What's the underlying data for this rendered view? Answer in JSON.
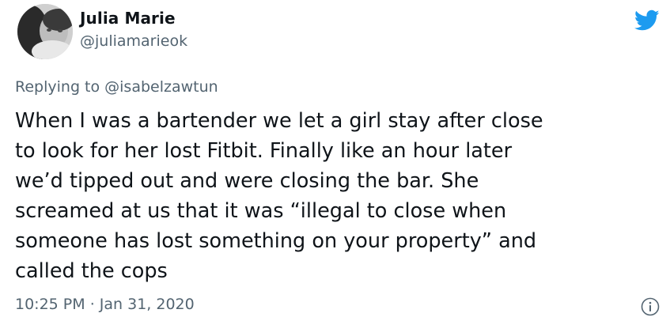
{
  "tweet": {
    "author_name": "Julia Marie",
    "author_handle": "@juliamarieok",
    "replying_prefix": "Replying to ",
    "replying_to": "@isabelzawtun",
    "lines": [
      "When I was a bartender we let a girl stay after close",
      "to look for her lost Fitbit. Finally like an hour later",
      "we’d tipped out and were closing the bar. She",
      "screamed at us that it was “illegal to close when",
      "someone has lost something on your property” and",
      "called the cops"
    ],
    "time": "10:25 PM",
    "separator": " · ",
    "date": "Jan 31, 2020"
  },
  "icons": {
    "brand": "twitter-bird-icon",
    "info": "info-icon"
  },
  "colors": {
    "brand": "#1d9bf0",
    "secondary_text": "#536471",
    "primary_text": "#0f1419"
  }
}
